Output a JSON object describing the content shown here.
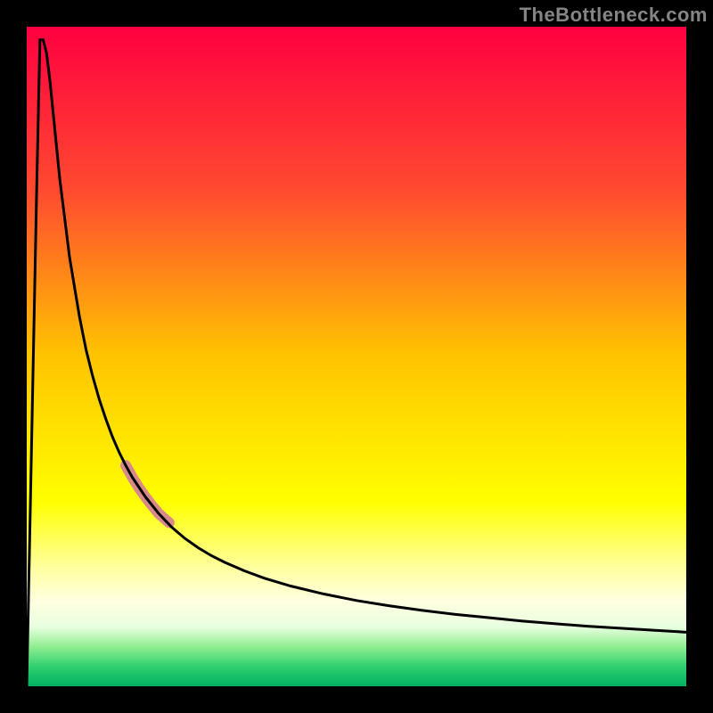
{
  "attribution": "TheBottleneck.com",
  "chart_data": {
    "type": "line",
    "title": "",
    "xlabel": "",
    "ylabel": "",
    "xlim": [
      0,
      1
    ],
    "ylim": [
      0,
      1
    ],
    "background_gradient": {
      "stops": [
        {
          "pos": 0.0,
          "color": "#ff0040"
        },
        {
          "pos": 0.25,
          "color": "#ff4b30"
        },
        {
          "pos": 0.5,
          "color": "#ffc400"
        },
        {
          "pos": 0.72,
          "color": "#ffff00"
        },
        {
          "pos": 0.82,
          "color": "#ffffa0"
        },
        {
          "pos": 0.87,
          "color": "#ffffe0"
        },
        {
          "pos": 0.91,
          "color": "#e8ffe0"
        },
        {
          "pos": 0.94,
          "color": "#90ee90"
        },
        {
          "pos": 0.97,
          "color": "#30d070"
        },
        {
          "pos": 1.0,
          "color": "#00b060"
        }
      ]
    },
    "series": [
      {
        "name": "bottleneck-curve",
        "color": "#000000",
        "x": [
          0.0,
          0.005,
          0.01,
          0.015,
          0.02,
          0.025,
          0.03,
          0.035,
          0.04,
          0.045,
          0.05,
          0.055,
          0.06,
          0.065,
          0.07,
          0.08,
          0.09,
          0.1,
          0.11,
          0.12,
          0.13,
          0.14,
          0.15,
          0.16,
          0.18,
          0.2,
          0.22,
          0.24,
          0.26,
          0.28,
          0.3,
          0.33,
          0.36,
          0.4,
          0.45,
          0.5,
          0.55,
          0.6,
          0.65,
          0.7,
          0.75,
          0.8,
          0.85,
          0.9,
          0.95,
          1.0
        ],
        "y": [
          0.0,
          0.25,
          0.5,
          0.75,
          0.98,
          0.98,
          0.96,
          0.92,
          0.87,
          0.82,
          0.77,
          0.73,
          0.69,
          0.65,
          0.62,
          0.56,
          0.51,
          0.47,
          0.435,
          0.405,
          0.378,
          0.355,
          0.335,
          0.317,
          0.287,
          0.262,
          0.241,
          0.224,
          0.21,
          0.198,
          0.188,
          0.175,
          0.164,
          0.152,
          0.14,
          0.13,
          0.122,
          0.115,
          0.109,
          0.104,
          0.099,
          0.095,
          0.091,
          0.088,
          0.085,
          0.082
        ]
      }
    ],
    "highlight": {
      "name": "highlight-segment",
      "color": "#d88a8a",
      "x": [
        0.15,
        0.16,
        0.17,
        0.18,
        0.19,
        0.2,
        0.216
      ],
      "y": [
        0.335,
        0.317,
        0.301,
        0.287,
        0.274,
        0.262,
        0.248
      ]
    }
  }
}
